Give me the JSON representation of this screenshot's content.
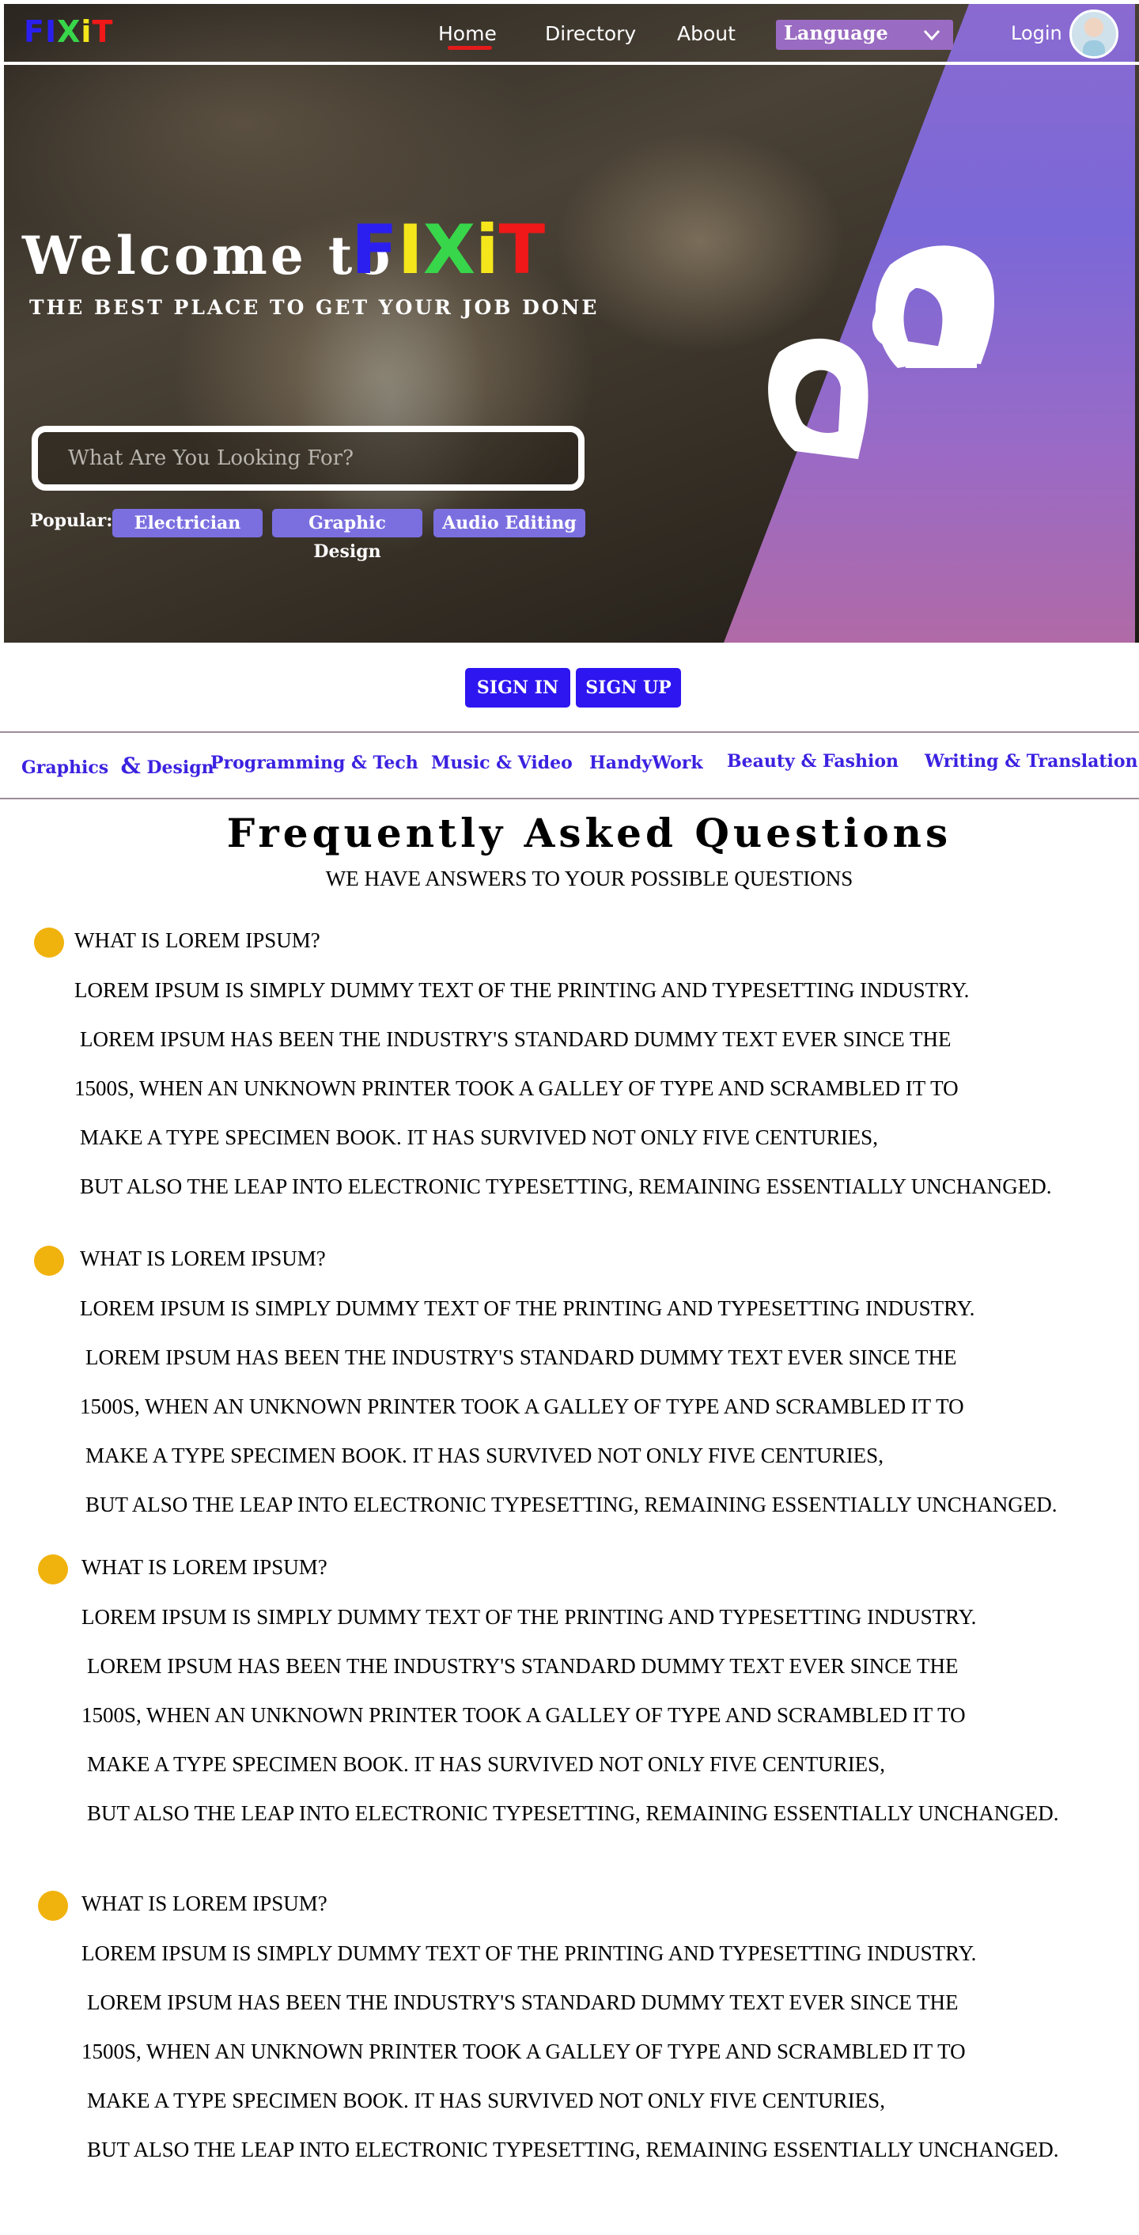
{
  "header": {
    "logo": {
      "l1": "F",
      "l2": "I",
      "l3": "X",
      "l4": "i",
      "l5": "T"
    },
    "nav": {
      "home": "Home",
      "directory": "Directory",
      "about": "About"
    },
    "language": "Language",
    "login": "Login",
    "avatar_icon": "user-avatar"
  },
  "hero": {
    "welcome": "Welcome to",
    "logo": {
      "l1": "F",
      "l2": "I",
      "l3": "X",
      "l4": "i",
      "l5": "T"
    },
    "tagline": "THE BEST PLACE TO GET YOUR JOB DONE",
    "search_placeholder": "What Are You Looking For?",
    "popular_label": "Popular:",
    "popular": [
      "Electrician",
      "Graphic Design",
      "Audio Editing"
    ],
    "colors": {
      "logo_blue": "#2b1ff0",
      "logo_yellow": "#f5e61c",
      "logo_green": "#38d64a",
      "logo_red": "#f01818",
      "band": "#8a6ad0",
      "pill": "#7b6fe0"
    }
  },
  "auth": {
    "sign_in": "SIGN IN",
    "sign_up": "SIGN UP",
    "color": "#2e16f0"
  },
  "categories": {
    "graphics": "Graphics",
    "graphics_amp": "&",
    "graphics_design": "Design",
    "programming": "Programming & Tech",
    "music": "Music & Video",
    "handywork": "HandyWork",
    "beauty": "Beauty & Fashion",
    "writing": "Writing & Translation"
  },
  "faq": {
    "title": "Frequently Asked Questions",
    "subtitle": "WE HAVE ANSWERS TO YOUR POSSIBLE QUESTIONS",
    "dot_color": "#f0b20c",
    "items": [
      {
        "question": "WHAT IS LOREM IPSUM?",
        "lines": [
          "LOREM IPSUM IS SIMPLY DUMMY TEXT OF THE PRINTING AND TYPESETTING INDUSTRY.",
          "LOREM IPSUM HAS BEEN THE INDUSTRY'S STANDARD DUMMY TEXT EVER SINCE THE",
          "1500S, WHEN AN UNKNOWN PRINTER TOOK A GALLEY OF TYPE AND SCRAMBLED IT TO",
          "MAKE A TYPE SPECIMEN BOOK. IT HAS SURVIVED NOT ONLY FIVE CENTURIES,",
          "BUT ALSO THE LEAP INTO ELECTRONIC TYPESETTING, REMAINING ESSENTIALLY UNCHANGED."
        ]
      },
      {
        "question": "WHAT IS LOREM IPSUM?",
        "lines": [
          "LOREM IPSUM IS SIMPLY DUMMY TEXT OF THE PRINTING AND TYPESETTING INDUSTRY.",
          "LOREM IPSUM HAS BEEN THE INDUSTRY'S STANDARD DUMMY TEXT EVER SINCE THE",
          "1500S, WHEN AN UNKNOWN PRINTER TOOK A GALLEY OF TYPE AND SCRAMBLED IT TO",
          "MAKE A TYPE SPECIMEN BOOK. IT HAS SURVIVED NOT ONLY FIVE CENTURIES,",
          "BUT ALSO THE LEAP INTO ELECTRONIC TYPESETTING, REMAINING ESSENTIALLY UNCHANGED."
        ]
      },
      {
        "question": "WHAT IS LOREM IPSUM?",
        "lines": [
          "LOREM IPSUM IS SIMPLY DUMMY TEXT OF THE PRINTING AND TYPESETTING INDUSTRY.",
          "LOREM IPSUM HAS BEEN THE INDUSTRY'S STANDARD DUMMY TEXT EVER SINCE THE",
          "1500S, WHEN AN UNKNOWN PRINTER TOOK A GALLEY OF TYPE AND SCRAMBLED IT TO",
          "MAKE A TYPE SPECIMEN BOOK. IT HAS SURVIVED NOT ONLY FIVE CENTURIES,",
          "BUT ALSO THE LEAP INTO ELECTRONIC TYPESETTING, REMAINING ESSENTIALLY UNCHANGED."
        ]
      },
      {
        "question": "WHAT IS LOREM IPSUM?",
        "lines": [
          "LOREM IPSUM IS SIMPLY DUMMY TEXT OF THE PRINTING AND TYPESETTING INDUSTRY.",
          "LOREM IPSUM HAS BEEN THE INDUSTRY'S STANDARD DUMMY TEXT EVER SINCE THE",
          "1500S, WHEN AN UNKNOWN PRINTER TOOK A GALLEY OF TYPE AND SCRAMBLED IT TO",
          "MAKE A TYPE SPECIMEN BOOK. IT HAS SURVIVED NOT ONLY FIVE CENTURIES,",
          "BUT ALSO THE LEAP INTO ELECTRONIC TYPESETTING, REMAINING ESSENTIALLY UNCHANGED."
        ]
      }
    ]
  }
}
